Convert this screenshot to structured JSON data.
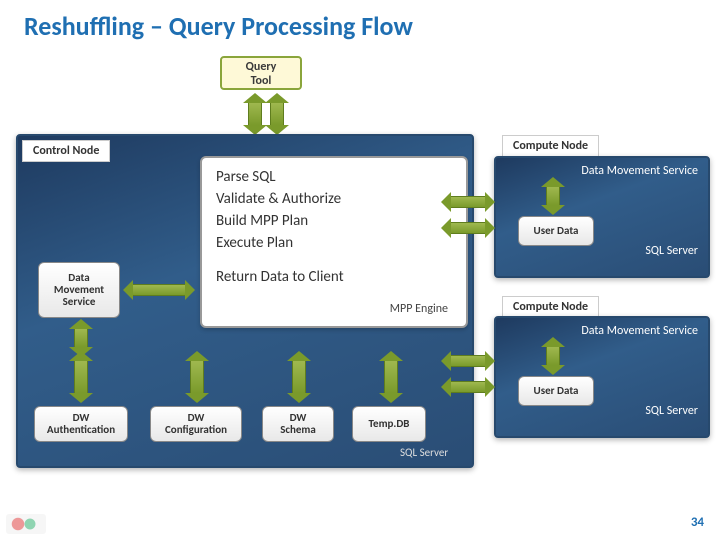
{
  "title": "Reshuffling – Query Processing Flow",
  "query_tool": "Query\nTool",
  "control_node_label": "Control Node",
  "compute_node_label": "Compute Node",
  "steps": {
    "s1": "Parse SQL",
    "s2": "Validate & Authorize",
    "s3": "Build MPP Plan",
    "s4": "Execute Plan",
    "s5": "Return Data to Client",
    "mpp": "MPP Engine"
  },
  "dms_label": "Data\nMovement\nService",
  "dw_auth": "DW\nAuthentication",
  "dw_conf": "DW\nConfiguration",
  "dw_schema": "DW\nSchema",
  "temp_db": "Temp.DB",
  "sql_server": "SQL Server",
  "compute": {
    "dms": "Data Movement Service",
    "user_data": "User Data"
  },
  "page_number": "34"
}
